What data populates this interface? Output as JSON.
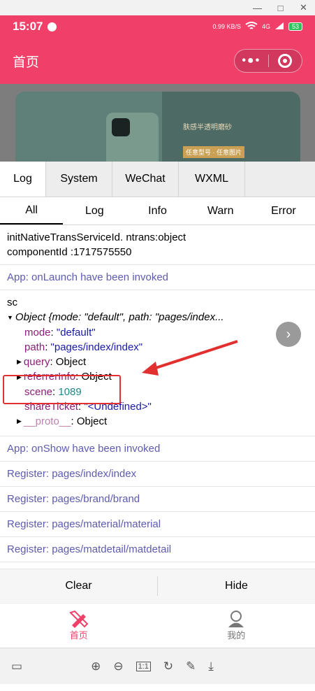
{
  "window": {
    "minimize": "—",
    "maximize": "□",
    "close": "✕"
  },
  "status": {
    "time": "15:07",
    "net_speed": "0.99 KB/S",
    "signal": "4G",
    "battery": "53"
  },
  "nav": {
    "title": "首页"
  },
  "banner": {
    "text": "肤感半透明磨砂",
    "tags": "任意型号 · 任意图片"
  },
  "debug_tabs": [
    "Log",
    "System",
    "WeChat",
    "WXML"
  ],
  "filter_tabs": [
    "All",
    "Log",
    "Info",
    "Warn",
    "Error"
  ],
  "logs": {
    "l1_a": "initNativeTransServiceId. ntrans:object",
    "l1_b": "componentId :1717575550",
    "l2": "App: onLaunch have been invoked",
    "sc": "sc",
    "obj_head": "Object {mode: \"default\", path: \"pages/index...",
    "mode_k": "mode",
    "mode_v": "\"default\"",
    "path_k": "path",
    "path_v": "\"pages/index/index\"",
    "query_k": "query",
    "query_v": "Object",
    "ref_k": "referrerInfo",
    "ref_v": "Object",
    "scene_k": "scene",
    "scene_v": "1089",
    "share_k": "shareTicket",
    "share_v": "\"<Undefined>\"",
    "proto_k": "__proto__",
    "proto_v": "Object",
    "l4": "App: onShow have been invoked",
    "l5": "Register: pages/index/index",
    "l6": "Register: pages/brand/brand",
    "l7": "Register: pages/material/material",
    "l8": "Register: pages/matdetail/matdetail"
  },
  "bottom": {
    "clear": "Clear",
    "hide": "Hide"
  },
  "tabbar": {
    "home": "首页",
    "mine": "我的"
  },
  "colors": {
    "brand": "#f0406a",
    "log_blue": "#5d5bb0",
    "highlight": "#e23030"
  }
}
